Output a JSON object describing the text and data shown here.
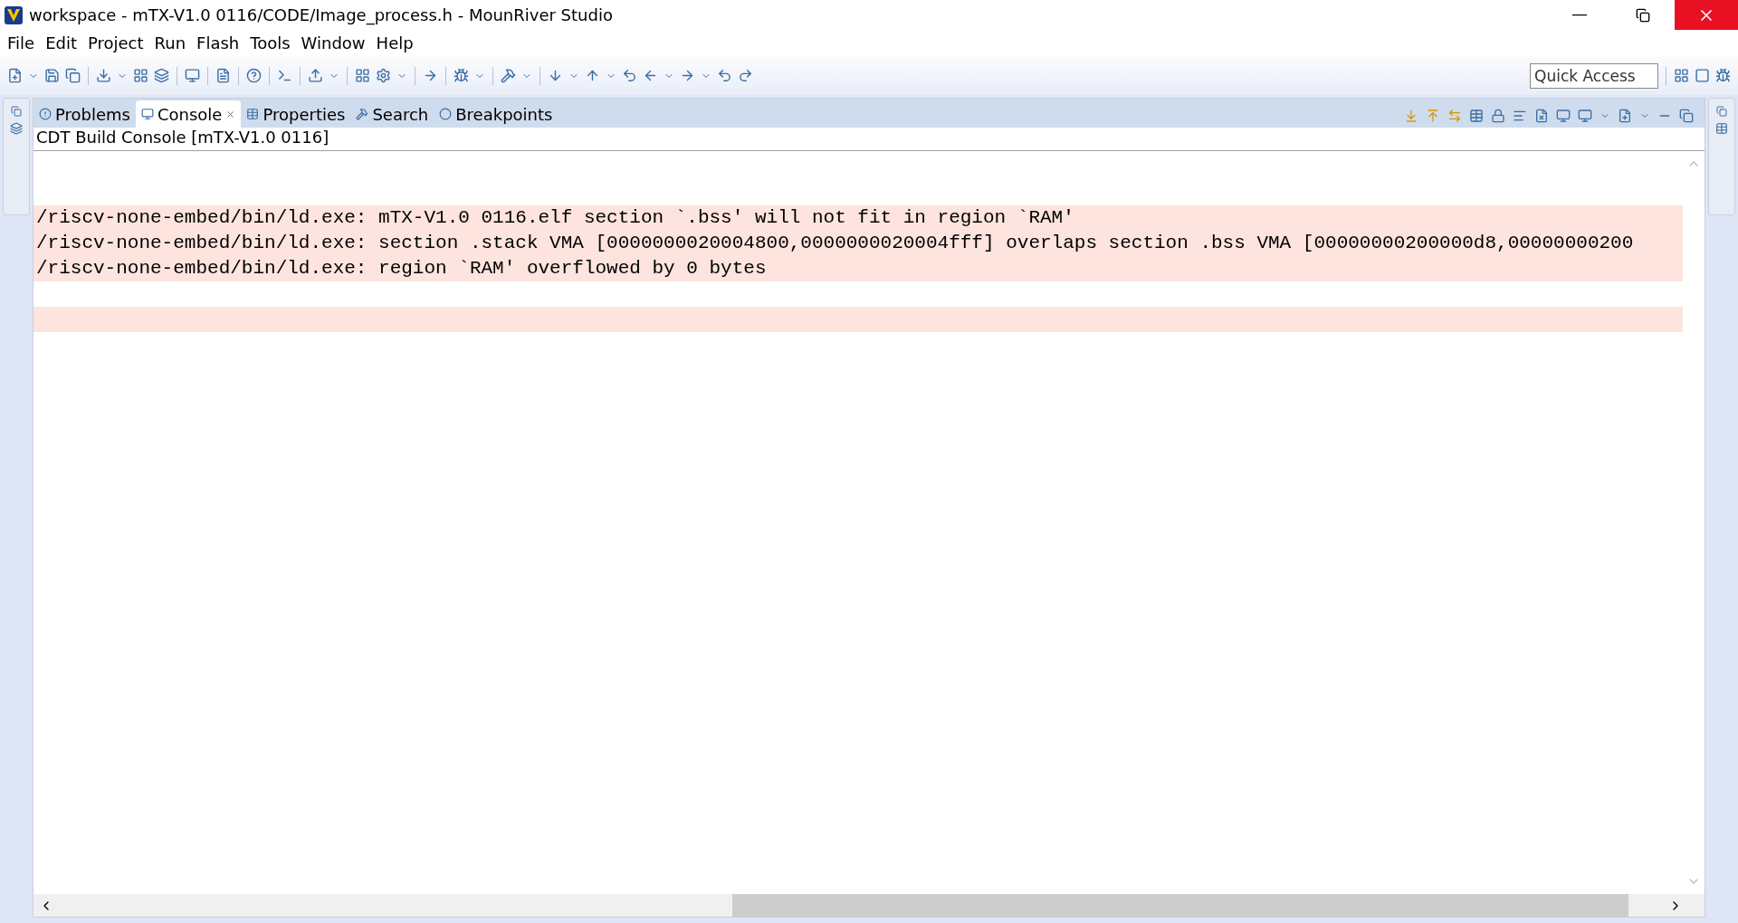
{
  "window": {
    "title": "workspace - mTX-V1.0 0116/CODE/Image_process.h - MounRiver Studio"
  },
  "menu": [
    "File",
    "Edit",
    "Project",
    "Run",
    "Flash",
    "Tools",
    "Window",
    "Help"
  ],
  "quick_access": {
    "placeholder": "Quick Access"
  },
  "tabs": [
    {
      "label": "Problems",
      "selected": false,
      "closable": false
    },
    {
      "label": "Console",
      "selected": true,
      "closable": true
    },
    {
      "label": "Properties",
      "selected": false,
      "closable": false
    },
    {
      "label": "Search",
      "selected": false,
      "closable": false
    },
    {
      "label": "Breakpoints",
      "selected": false,
      "closable": false
    }
  ],
  "console": {
    "title": "CDT Build Console [mTX-V1.0 0116]",
    "lines": [
      {
        "kind": "blank"
      },
      {
        "kind": "blank"
      },
      {
        "kind": "text",
        "text": "/riscv-none-embed/bin/ld.exe: mTX-V1.0 0116.elf section `.bss' will not fit in region `RAM'",
        "highlighted": true
      },
      {
        "kind": "text",
        "text": "/riscv-none-embed/bin/ld.exe: section .stack VMA [0000000020004800,0000000020004fff] overlaps section .bss VMA [00000000200000d8,00000000200",
        "highlighted": true
      },
      {
        "kind": "text",
        "text": "/riscv-none-embed/bin/ld.exe: region `RAM' overflowed by 0 bytes",
        "highlighted": true
      },
      {
        "kind": "blank"
      },
      {
        "kind": "text",
        "highlighted": true
      }
    ]
  }
}
